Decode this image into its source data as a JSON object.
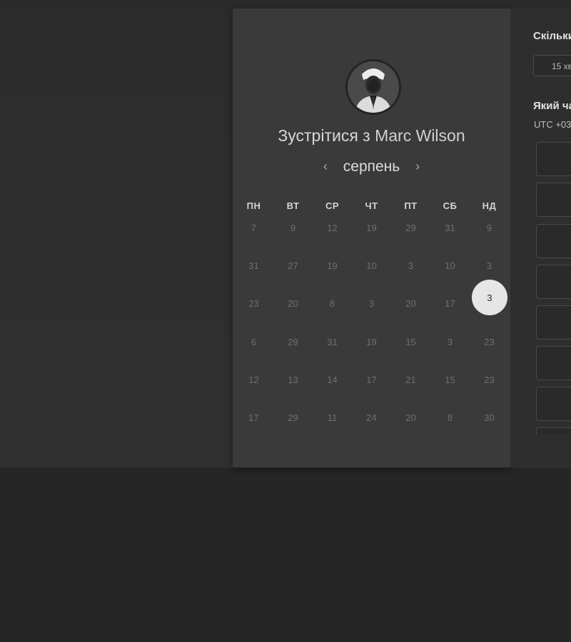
{
  "booking": {
    "title_prefix": "Зустрітися з",
    "host_name": "Marc Wilson",
    "month": "серпень",
    "prev_icon": "chevron-left-icon",
    "next_icon": "chevron-right-icon",
    "weekdays": [
      "ПН",
      "ВТ",
      "СР",
      "ЧТ",
      "ПТ",
      "СБ",
      "НД"
    ],
    "weeks": [
      [
        "7",
        "9",
        "12",
        "19",
        "29",
        "31",
        "9"
      ],
      [
        "31",
        "27",
        "19",
        "10",
        "3",
        "10",
        "3"
      ],
      [
        "23",
        "20",
        "8",
        "3",
        "20",
        "17",
        "3"
      ],
      [
        "6",
        "29",
        "31",
        "19",
        "15",
        "3",
        "23"
      ],
      [
        "12",
        "13",
        "14",
        "17",
        "21",
        "15",
        "23"
      ],
      [
        "17",
        "29",
        "11",
        "24",
        "20",
        "8",
        "30"
      ]
    ],
    "selected_day": "3"
  },
  "side_panel": {
    "duration_heading": "Скільки",
    "duration_value": "15 хв",
    "time_heading": "Який ча",
    "timezone": "UTC +03"
  },
  "colors": {
    "background": "#262626",
    "card": "#3a3a3a",
    "selected": "#e6e6e6"
  }
}
